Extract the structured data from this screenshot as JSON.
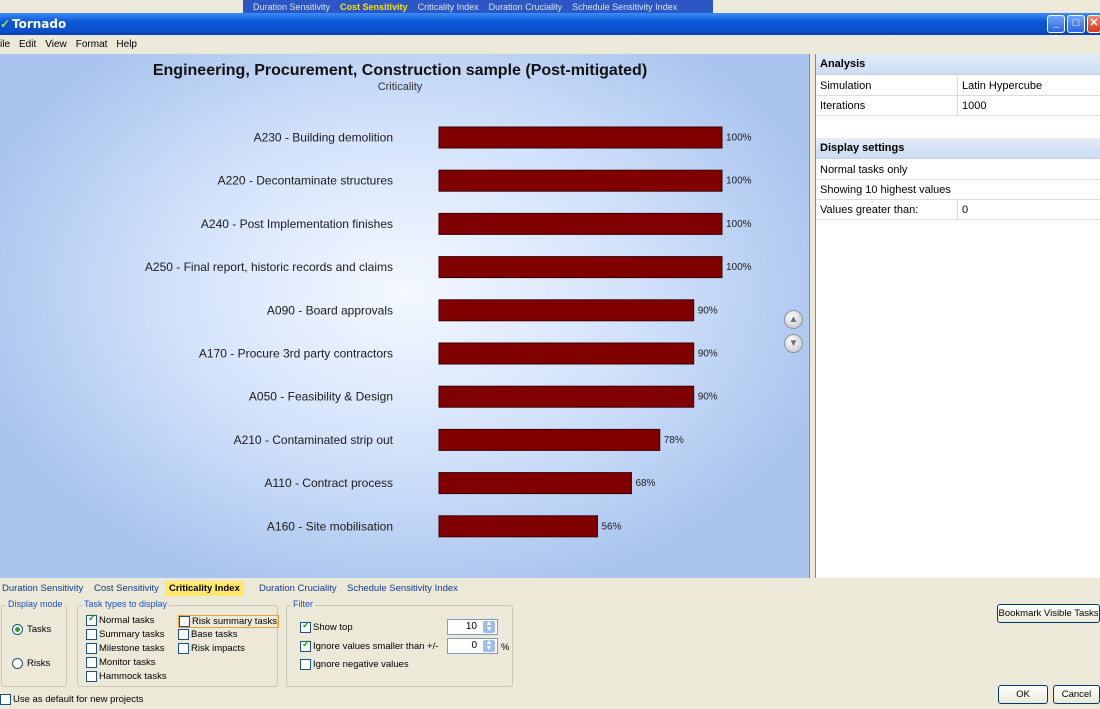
{
  "background_tabs": [
    "Duration Sensitivity",
    "Cost Sensitivity",
    "Criticality Index",
    "Duration Cruciality",
    "Schedule Sensitivity Index"
  ],
  "window": {
    "title": "Tornado"
  },
  "menu": [
    "ile",
    "Edit",
    "View",
    "Format",
    "Help"
  ],
  "chart": {
    "title": "Engineering, Procurement, Construction sample (Post-mitigated)",
    "subtitle": "Criticality"
  },
  "chart_data": {
    "type": "bar",
    "orientation": "horizontal",
    "title": "Engineering, Procurement, Construction sample (Post-mitigated)",
    "subtitle": "Criticality",
    "categories": [
      "A230 - Building demolition",
      "A220 - Decontaminate structures",
      "A240 - Post Implementation finishes",
      "A250 - Final report, historic records and claims",
      "A090 - Board approvals",
      "A170 - Procure 3rd party contractors",
      "A050 - Feasibility & Design",
      "A210 - Contaminated strip out",
      "A110 - Contract process",
      "A160 - Site mobilisation"
    ],
    "values": [
      100,
      100,
      100,
      100,
      90,
      90,
      90,
      78,
      68,
      56
    ],
    "value_labels": [
      "100%",
      "100%",
      "100%",
      "100%",
      "90%",
      "90%",
      "90%",
      "78%",
      "68%",
      "56%"
    ],
    "xlim": [
      0,
      100
    ],
    "bar_color": "#800000",
    "grid": false
  },
  "panel": {
    "analysis_header": "Analysis",
    "analysis_rows": [
      {
        "key": "Simulation",
        "value": "Latin Hypercube"
      },
      {
        "key": "Iterations",
        "value": "1000"
      }
    ],
    "display_header": "Display settings",
    "display_rows": [
      {
        "key": "Normal tasks only",
        "value": ""
      },
      {
        "key": "Showing 10 highest values",
        "value": ""
      },
      {
        "key": "Values greater than:",
        "value": "0"
      }
    ]
  },
  "tabs": [
    "Duration Sensitivity",
    "Cost Sensitivity",
    "Criticality Index",
    "Duration Cruciality",
    "Schedule Sensitivity Index"
  ],
  "active_tab": "Criticality Index",
  "display_mode": {
    "title": "Display mode",
    "options": [
      "Tasks",
      "Risks"
    ],
    "selected": "Tasks"
  },
  "task_types": {
    "title": "Task types to display",
    "items": [
      {
        "label": "Normal tasks",
        "checked": true
      },
      {
        "label": "Summary tasks",
        "checked": false
      },
      {
        "label": "Milestone tasks",
        "checked": false
      },
      {
        "label": "Monitor tasks",
        "checked": false
      },
      {
        "label": "Hammock tasks",
        "checked": false
      },
      {
        "label": "Risk summary tasks",
        "checked": false
      },
      {
        "label": "Base tasks",
        "checked": false
      },
      {
        "label": "Risk impacts",
        "checked": false
      }
    ]
  },
  "filter": {
    "title": "Filter",
    "show_top_label": "Show top",
    "show_top_value": "10",
    "ignore_smaller_label": "Ignore values smaller than +/-",
    "ignore_smaller_value": "0",
    "percent": "%",
    "ignore_negative_label": "Ignore negative values"
  },
  "buttons": {
    "bookmark": "Bookmark Visible Tasks",
    "ok": "OK",
    "cancel": "Cancel"
  },
  "use_default_label": "Use as default for new projects"
}
